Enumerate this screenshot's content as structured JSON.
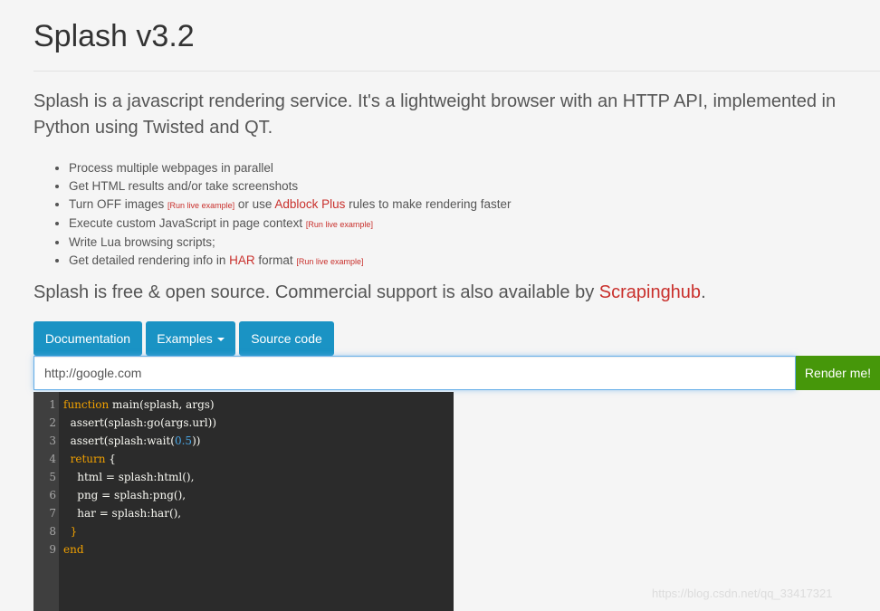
{
  "header": {
    "title": "Splash v3.2"
  },
  "intro": {
    "lead": "Splash is a javascript rendering service. It's a lightweight browser with an HTTP API, implemented in Python using Twisted and QT."
  },
  "features": [
    {
      "text": "Process multiple webpages in parallel"
    },
    {
      "text": "Get HTML results and/or take screenshots"
    },
    {
      "before": "Turn OFF images",
      "live": "[Run live example]",
      "mid": " or use ",
      "link": "Adblock Plus",
      "after": " rules to make rendering faster"
    },
    {
      "before": "Execute custom JavaScript in page context",
      "live": "[Run live example]"
    },
    {
      "text": "Write Lua browsing scripts;"
    },
    {
      "before": "Get detailed rendering info in ",
      "link": "HAR",
      "mid": " format",
      "live": "[Run live example]"
    }
  ],
  "free": {
    "before": "Splash is free & open source. Commercial support is also available by ",
    "link": "Scrapinghub",
    "after": "."
  },
  "nav": {
    "documentation": "Documentation",
    "examples": "Examples",
    "source": "Source code"
  },
  "form": {
    "url_value": "http://google.com",
    "render_label": "Render me!"
  },
  "editor": {
    "line_numbers": [
      "1",
      "2",
      "3",
      "4",
      "5",
      "6",
      "7",
      "8",
      "9"
    ],
    "l1_kw": "function",
    "l1_rest": " main(splash, args)",
    "l2": "  assert(splash:go(args.url))",
    "l3_a": "  assert(splash:wait(",
    "l3_num": "0.5",
    "l3_b": "))",
    "l4_kw": "  return",
    "l4_rest": " {",
    "l5": "    html = splash:html(),",
    "l6": "    png = splash:png(),",
    "l7": "    har = splash:har(),",
    "l8": "  }",
    "l9_kw": "end"
  },
  "watermark": "https://blog.csdn.net/qq_33417321",
  "colors": {
    "button_blue": "#1a93c4",
    "render_green": "#46970a",
    "link_red": "#c9302c",
    "editor_bg": "#2b2b2b",
    "keyword": "#f0a000",
    "number": "#4aa7e6"
  },
  "icons": {
    "dropdown_caret": "caret-down-icon"
  }
}
